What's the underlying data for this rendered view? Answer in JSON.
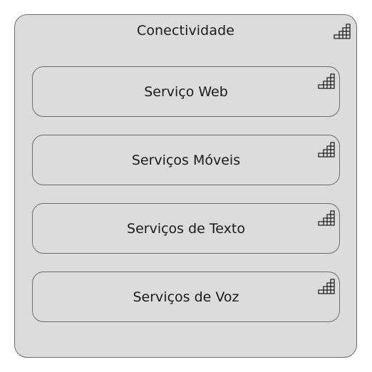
{
  "container": {
    "title": "Conectividade",
    "icon": "component-grid-icon"
  },
  "components": [
    {
      "label": "Serviço Web",
      "icon": "component-grid-icon"
    },
    {
      "label": "Serviços Móveis",
      "icon": "component-grid-icon"
    },
    {
      "label": "Serviços de Texto",
      "icon": "component-grid-icon"
    },
    {
      "label": "Serviços de Voz",
      "icon": "component-grid-icon"
    }
  ],
  "colors": {
    "fill": "#dcdcdc",
    "border": "#6b6b6b",
    "text": "#1a1a1a"
  }
}
